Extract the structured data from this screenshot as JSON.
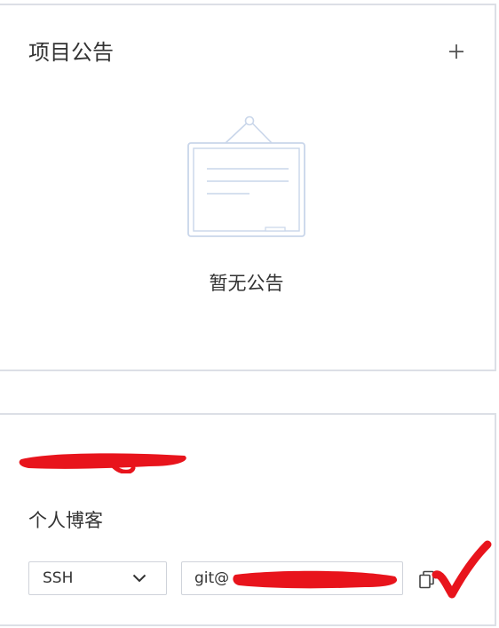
{
  "announcements": {
    "title": "项目公告",
    "add_icon": "plus-icon",
    "empty_text": "暂无公告",
    "illustration_icon": "notice-board-icon"
  },
  "repo": {
    "redacted_title_note": "",
    "label": "个人博客",
    "protocol": {
      "selected": "SSH",
      "icon": "chevron-down-icon"
    },
    "clone_url": {
      "value_prefix": "git@"
    },
    "copy_icon": "copy-icon"
  },
  "colors": {
    "border": "#dcdfe6",
    "text": "#333333",
    "illustration": "#c9d6ea",
    "annotation_red": "#e8141c"
  }
}
